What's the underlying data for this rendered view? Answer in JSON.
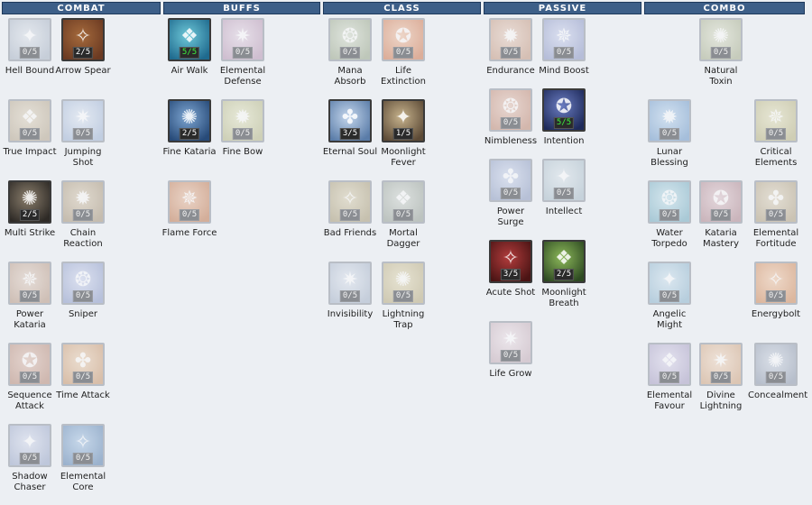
{
  "sections": [
    {
      "id": "combat",
      "title": "COMBAT"
    },
    {
      "id": "buffs",
      "title": "BUFFS"
    },
    {
      "id": "class",
      "title": "CLASS"
    },
    {
      "id": "passive",
      "title": "PASSIVE"
    },
    {
      "id": "combo",
      "title": "COMBO"
    }
  ],
  "skills": [
    {
      "section": "combat",
      "name": "Hell Bound",
      "level": "0/5",
      "icon": "hell-bound-icon",
      "colors": [
        "#a8b4c4",
        "#dde3ea"
      ]
    },
    {
      "section": "combat",
      "name": "Arrow Spear",
      "level": "2/5",
      "icon": "arrow-spear-icon",
      "colors": [
        "#6b3a22",
        "#a56a3c"
      ]
    },
    {
      "section": "combat",
      "name": "True Impact",
      "level": "0/5",
      "icon": "true-impact-icon",
      "colors": [
        "#b6a890",
        "#ded4c0"
      ]
    },
    {
      "section": "combat",
      "name": "Jumping Shot",
      "level": "0/5",
      "icon": "jumping-shot-icon",
      "colors": [
        "#9fb4d4",
        "#dde6f2"
      ]
    },
    {
      "section": "combat",
      "name": "Multi Strike",
      "level": "2/5",
      "icon": "multi-strike-icon",
      "colors": [
        "#2e2a26",
        "#8a7e6c"
      ]
    },
    {
      "section": "combat",
      "name": "Chain Reaction",
      "level": "0/5",
      "icon": "chain-reaction-icon",
      "colors": [
        "#a69478",
        "#d6c9b2"
      ]
    },
    {
      "section": "combat",
      "name": "Power Kataria",
      "level": "0/5",
      "icon": "power-kataria-icon",
      "colors": [
        "#b89a86",
        "#e0cfc2"
      ]
    },
    {
      "section": "combat",
      "name": "Sniper",
      "level": "0/5",
      "icon": "sniper-icon",
      "colors": [
        "#8c9cc8",
        "#cfd6ee"
      ]
    },
    {
      "section": "combat",
      "name": "Sequence Attack",
      "level": "0/5",
      "icon": "sequence-attack-icon",
      "colors": [
        "#b88c7a",
        "#dcbeb0"
      ]
    },
    {
      "section": "combat",
      "name": "Time Attack",
      "level": "0/5",
      "icon": "time-attack-icon",
      "colors": [
        "#c9986e",
        "#ead0b4"
      ]
    },
    {
      "section": "combat",
      "name": "Shadow Chaser",
      "level": "0/5",
      "icon": "shadow-chaser-icon",
      "colors": [
        "#9aa8c8",
        "#d6dced"
      ]
    },
    {
      "section": "combat",
      "name": "Elemental Core",
      "level": "0/5",
      "icon": "elemental-core-icon",
      "colors": [
        "#5a82b0",
        "#a9c6e4"
      ]
    },
    {
      "section": "buffs",
      "name": "Air Walk",
      "level": "5/5",
      "icon": "air-walk-icon",
      "colors": [
        "#1f6a8e",
        "#6ec8d8"
      ]
    },
    {
      "section": "buffs",
      "name": "Elemental Defense",
      "level": "0/5",
      "icon": "elemental-defense-icon",
      "colors": [
        "#b898b4",
        "#e2d4e2"
      ]
    },
    {
      "section": "buffs",
      "name": "Fine Kataria",
      "level": "2/5",
      "icon": "fine-kataria-icon",
      "colors": [
        "#274a78",
        "#7ea6d2"
      ]
    },
    {
      "section": "buffs",
      "name": "Fine Bow",
      "level": "0/5",
      "icon": "fine-bow-icon",
      "colors": [
        "#b6b888",
        "#e2e4c2"
      ]
    },
    {
      "section": "buffs",
      "name": "Flame Force",
      "level": "0/5",
      "icon": "flame-force-icon",
      "colors": [
        "#c07a52",
        "#e8bea2"
      ]
    },
    {
      "section": "class",
      "name": "Mana Absorb",
      "level": "0/5",
      "icon": "mana-absorb-icon",
      "colors": [
        "#9aa88c",
        "#d4dccc"
      ]
    },
    {
      "section": "class",
      "name": "Life Extinction",
      "level": "0/5",
      "icon": "life-extinction-icon",
      "colors": [
        "#d07a52",
        "#eec2a6"
      ]
    },
    {
      "section": "class",
      "name": "Eternal Soul",
      "level": "3/5",
      "icon": "eternal-soul-icon",
      "colors": [
        "#5a7ca8",
        "#c4d6ec"
      ]
    },
    {
      "section": "class",
      "name": "Moonlight Fever",
      "level": "1/5",
      "icon": "moonlight-fever-icon",
      "colors": [
        "#5c4a36",
        "#c6b28c"
      ]
    },
    {
      "section": "class",
      "name": "Bad Friends",
      "level": "0/5",
      "icon": "bad-friends-icon",
      "colors": [
        "#a89c78",
        "#d8d0b4"
      ]
    },
    {
      "section": "class",
      "name": "Mortal Dagger",
      "level": "0/5",
      "icon": "mortal-dagger-icon",
      "colors": [
        "#96a096",
        "#d0d6d0"
      ]
    },
    {
      "section": "class",
      "name": "Invisibility",
      "level": "0/5",
      "icon": "invisibility-icon",
      "colors": [
        "#a6b4c8",
        "#dde4ee"
      ]
    },
    {
      "section": "class",
      "name": "Lightning Trap",
      "level": "0/5",
      "icon": "lightning-trap-icon",
      "colors": [
        "#b8ac80",
        "#e2dab8"
      ]
    },
    {
      "section": "passive",
      "name": "Endurance",
      "level": "0/5",
      "icon": "endurance-icon",
      "colors": [
        "#c49a82",
        "#e6cdbe"
      ]
    },
    {
      "section": "passive",
      "name": "Mind Boost",
      "level": "0/5",
      "icon": "mind-boost-icon",
      "colors": [
        "#8a96c4",
        "#cdd4ee"
      ]
    },
    {
      "section": "passive",
      "name": "Nimbleness",
      "level": "0/5",
      "icon": "nimbleness-icon",
      "colors": [
        "#c08a74",
        "#e4c4b6"
      ]
    },
    {
      "section": "passive",
      "name": "Intention",
      "level": "5/5",
      "icon": "intention-icon",
      "colors": [
        "#1e2a5a",
        "#6a7cc0"
      ]
    },
    {
      "section": "passive",
      "name": "Power Surge",
      "level": "0/5",
      "icon": "power-surge-icon",
      "colors": [
        "#8c9cc0",
        "#ccd6ec"
      ]
    },
    {
      "section": "passive",
      "name": "Intellect",
      "level": "0/5",
      "icon": "intellect-icon",
      "colors": [
        "#a8bcc8",
        "#dae4ea"
      ]
    },
    {
      "section": "passive",
      "name": "Acute Shot",
      "level": "3/5",
      "icon": "acute-shot-icon",
      "colors": [
        "#4a1414",
        "#b23c3c"
      ]
    },
    {
      "section": "passive",
      "name": "Moonlight Breath",
      "level": "2/5",
      "icon": "moonlight-breath-icon",
      "colors": [
        "#2e4a22",
        "#8cb85a"
      ]
    },
    {
      "section": "passive",
      "name": "Life Grow",
      "level": "0/5",
      "icon": "life-grow-icon",
      "colors": [
        "#c4aeb8",
        "#ece0e6"
      ]
    },
    {
      "section": "combo",
      "name": "Natural Toxin",
      "level": "0/5",
      "icon": "natural-toxin-icon",
      "colors": [
        "#a8b090",
        "#dce0cc"
      ]
    },
    {
      "section": "combo",
      "name": "Lunar Blessing",
      "level": "0/5",
      "icon": "lunar-blessing-icon",
      "colors": [
        "#6c98c8",
        "#bcd6ee"
      ]
    },
    {
      "section": "combo",
      "name": "Critical Elements",
      "level": "0/5",
      "icon": "critical-elements-icon",
      "colors": [
        "#b8b482",
        "#e2e0bc"
      ]
    },
    {
      "section": "combo",
      "name": "Water Torpedo",
      "level": "0/5",
      "icon": "water-torpedo-icon",
      "colors": [
        "#74acc0",
        "#c2e0ea"
      ]
    },
    {
      "section": "combo",
      "name": "Kataria Mastery",
      "level": "0/5",
      "icon": "kataria-mastery-icon",
      "colors": [
        "#b08890",
        "#dcc4ca"
      ]
    },
    {
      "section": "combo",
      "name": "Elemental Fortitude",
      "level": "0/5",
      "icon": "elemental-fortitude-icon",
      "colors": [
        "#b0a080",
        "#dcd2bc"
      ]
    },
    {
      "section": "combo",
      "name": "Angelic Might",
      "level": "0/5",
      "icon": "angelic-might-icon",
      "colors": [
        "#8cb4cc",
        "#cee2ee"
      ]
    },
    {
      "section": "combo",
      "name": "Energybolt",
      "level": "0/5",
      "icon": "energybolt-icon",
      "colors": [
        "#d08a5a",
        "#f0c8a8"
      ]
    },
    {
      "section": "combo",
      "name": "Elemental Favour",
      "level": "0/5",
      "icon": "elemental-favour-icon",
      "colors": [
        "#a8a0c4",
        "#dcd8ec"
      ]
    },
    {
      "section": "combo",
      "name": "Divine Lightning",
      "level": "0/5",
      "icon": "divine-lightning-icon",
      "colors": [
        "#d0a682",
        "#f0d8c2"
      ]
    },
    {
      "section": "combo",
      "name": "Concealment",
      "level": "0/5",
      "icon": "concealment-icon",
      "colors": [
        "#8c98ac",
        "#ccd4e0"
      ]
    }
  ]
}
